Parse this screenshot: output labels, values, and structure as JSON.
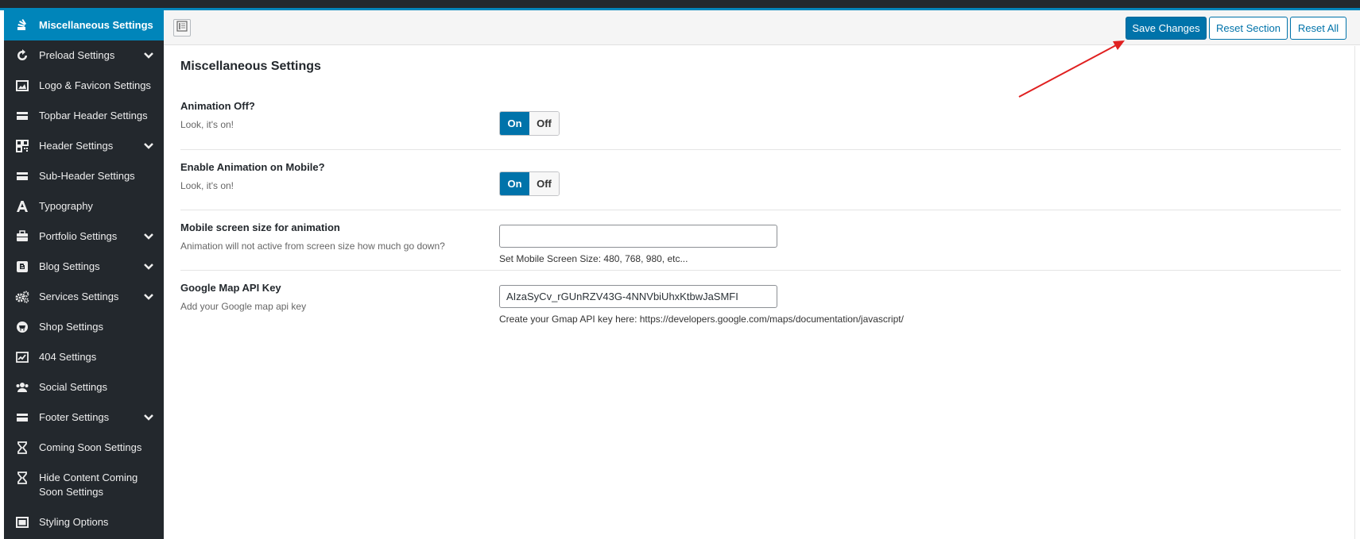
{
  "sidebar": {
    "items": [
      {
        "label": "Miscellaneous Settings",
        "icon": "stackexchange-icon",
        "active": true,
        "has_submenu": false
      },
      {
        "label": "Preload Settings",
        "icon": "refresh-icon",
        "has_submenu": true
      },
      {
        "label": "Logo & Favicon Settings",
        "icon": "image-icon",
        "has_submenu": false
      },
      {
        "label": "Topbar Header Settings",
        "icon": "credit-card-icon",
        "has_submenu": false
      },
      {
        "label": "Header Settings",
        "icon": "qrcode-icon",
        "has_submenu": true
      },
      {
        "label": "Sub-Header Settings",
        "icon": "credit-card-icon",
        "has_submenu": false
      },
      {
        "label": "Typography",
        "icon": "font-icon",
        "has_submenu": false
      },
      {
        "label": "Portfolio Settings",
        "icon": "briefcase-icon",
        "has_submenu": true
      },
      {
        "label": "Blog Settings",
        "icon": "blogger-icon",
        "has_submenu": true
      },
      {
        "label": "Services Settings",
        "icon": "cogs-icon",
        "has_submenu": true
      },
      {
        "label": "Shop Settings",
        "icon": "shop-icon",
        "has_submenu": false
      },
      {
        "label": "404 Settings",
        "icon": "area-chart-icon",
        "has_submenu": false
      },
      {
        "label": "Social Settings",
        "icon": "users-icon",
        "has_submenu": false
      },
      {
        "label": "Footer Settings",
        "icon": "credit-card-icon",
        "has_submenu": true
      },
      {
        "label": "Coming Soon Settings",
        "icon": "hourglass-icon",
        "has_submenu": false
      },
      {
        "label": "Hide Content Coming Soon Settings",
        "icon": "hourglass-icon",
        "has_submenu": false
      },
      {
        "label": "Styling Options",
        "icon": "window-icon",
        "has_submenu": false
      }
    ]
  },
  "toolbar": {
    "save_label": "Save Changes",
    "reset_section_label": "Reset Section",
    "reset_all_label": "Reset All"
  },
  "section": {
    "title": "Miscellaneous Settings"
  },
  "fields": {
    "animation_off": {
      "title": "Animation Off?",
      "desc": "Look, it's on!",
      "on_label": "On",
      "off_label": "Off",
      "value": "On"
    },
    "animation_mobile": {
      "title": "Enable Animation on Mobile?",
      "desc": "Look, it's on!",
      "on_label": "On",
      "off_label": "Off",
      "value": "On"
    },
    "mobile_size": {
      "title": "Mobile screen size for animation",
      "desc": "Animation will not active from screen size how much go down?",
      "value": "",
      "hint": "Set Mobile Screen Size: 480, 768, 980, etc..."
    },
    "gmap_key": {
      "title": "Google Map API Key",
      "desc": "Add your Google map api key",
      "value": "AIzaSyCv_rGUnRZV43G-4NNVbiUhxKtbwJaSMFI",
      "hint": "Create your Gmap API key here: https://developers.google.com/maps/documentation/javascript/"
    }
  },
  "colors": {
    "sidebar_bg": "#23282d",
    "accent": "#0085ba",
    "primary_button": "#0073aa",
    "annotation_arrow": "#e02020"
  }
}
